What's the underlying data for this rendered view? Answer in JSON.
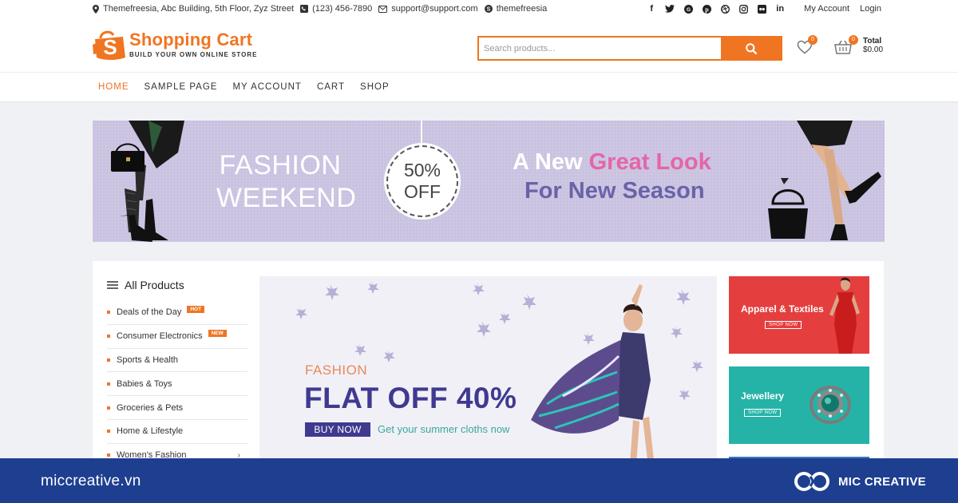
{
  "topbar": {
    "address": "Themefreesia, Abc Building, 5th Floor, Zyz Street",
    "phone": "(123) 456-7890",
    "email": "support@support.com",
    "skype": "themefreesia",
    "social_icons": [
      "facebook-icon",
      "twitter-icon",
      "google-plus-icon",
      "pinterest-icon",
      "dribbble-icon",
      "instagram-icon",
      "flickr-icon",
      "linkedin-icon"
    ],
    "my_account": "My Account",
    "login": "Login"
  },
  "header": {
    "logo_letter": "S",
    "site_name": "Shopping Cart",
    "tagline": "BUILD YOUR OWN ONLINE STORE",
    "search_placeholder": "Search products...",
    "wishlist_count": "0",
    "cart_count": "0",
    "total_label": "Total",
    "total_value": "$0.00",
    "accent": "#f07522"
  },
  "nav": {
    "items": [
      {
        "label": "HOME",
        "active": true
      },
      {
        "label": "SAMPLE PAGE"
      },
      {
        "label": "MY ACCOUNT"
      },
      {
        "label": "CART"
      },
      {
        "label": "SHOP"
      }
    ]
  },
  "banner": {
    "line1": "FASHION",
    "line2": "WEEKEND",
    "discount_pct": "50%",
    "discount_off": "OFF",
    "look_part1": "A New",
    "look_part2": "Great Look",
    "season": "For New Season"
  },
  "categories": {
    "title": "All Products",
    "items": [
      {
        "label": "Deals of the Day",
        "badge": "HOT"
      },
      {
        "label": "Consumer Electronics",
        "badge": "NEW"
      },
      {
        "label": "Sports & Health"
      },
      {
        "label": "Babies & Toys"
      },
      {
        "label": "Groceries & Pets"
      },
      {
        "label": "Home & Lifestyle"
      },
      {
        "label": "Women's Fashion",
        "has_submenu": true
      }
    ]
  },
  "promo": {
    "kicker": "FASHION",
    "headline": "FLAT OFF 40%",
    "button": "BUY NOW",
    "subline": "Get your summer cloths now"
  },
  "side_cards": [
    {
      "title": "Apparel & Textiles",
      "button": "SHOP NOW",
      "color": "#e53e3e"
    },
    {
      "title": "Jewellery",
      "button": "SHOP NOW",
      "color": "#26b3a7"
    }
  ],
  "footer": {
    "site": "miccreative.vn",
    "brand": "MIC CREATIVE",
    "color": "#1e3f90"
  }
}
